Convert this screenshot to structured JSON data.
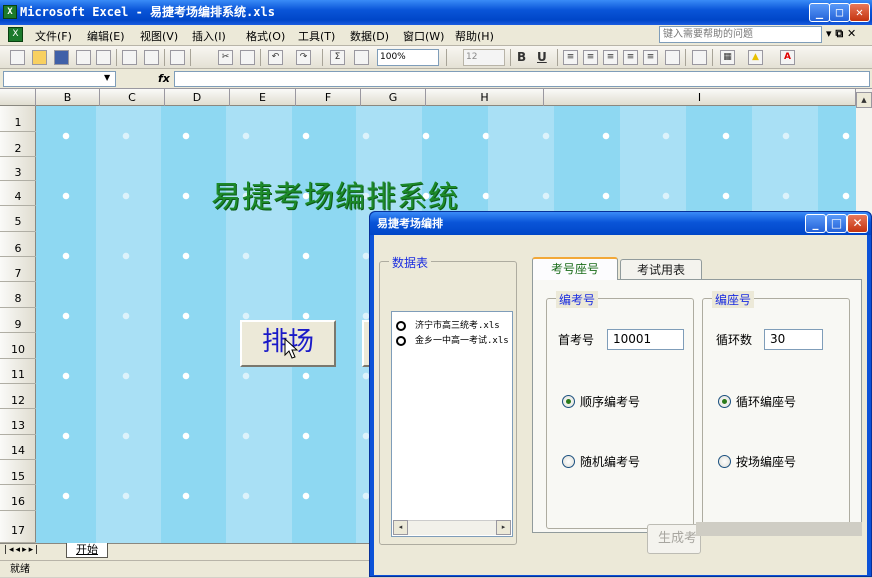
{
  "window": {
    "title": "Microsoft Excel - 易捷考场编排系统.xls",
    "min": "_",
    "max": "□",
    "close": "✕"
  },
  "menu": [
    "文件(F)",
    "编辑(E)",
    "视图(V)",
    "插入(I)",
    "格式(O)",
    "工具(T)",
    "数据(D)",
    "窗口(W)",
    "帮助(H)"
  ],
  "help_box": "键入需要帮助的问题",
  "toolbar": {
    "zoom": "100%",
    "font_size": "12",
    "bold": "B",
    "underline": "U",
    "fx": "fx"
  },
  "columns": [
    "B",
    "C",
    "D",
    "E",
    "F",
    "G",
    "H",
    "I"
  ],
  "rows": [
    "1",
    "2",
    "3",
    "4",
    "5",
    "6",
    "7",
    "8",
    "9",
    "10",
    "11",
    "12",
    "13",
    "14",
    "15",
    "16",
    "17"
  ],
  "sheet": {
    "title": "易捷考场编排系统",
    "button": "排场"
  },
  "sheet_tab": "开始",
  "status": "就绪",
  "dialog": {
    "title": "易捷考场编排",
    "left_group": "数据表",
    "files": [
      "济宁市高三统考.xls",
      "金乡一中高一考试.xls"
    ],
    "tabs": [
      "考号座号",
      "考试用表"
    ],
    "exam_group": {
      "title": "编考号",
      "first_label": "首考号",
      "first_value": "10001",
      "opt_seq": "顺序编考号",
      "opt_rand": "随机编考号"
    },
    "seat_group": {
      "title": "编座号",
      "cycle_label": "循环数",
      "cycle_value": "30",
      "opt_cycle": "循环编座号",
      "opt_room": "按场编座号"
    },
    "generate": "生成考"
  },
  "colors": {
    "title_blue": "#0a55d8",
    "sheet_bg": "#8ed8f2",
    "title_green": "#1d8a2a",
    "group_label": "#1a2ce0"
  }
}
